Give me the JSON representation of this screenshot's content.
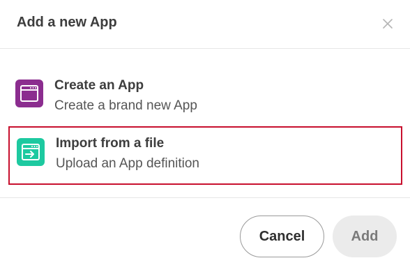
{
  "dialog": {
    "title": "Add a new App",
    "close_icon": "close-icon"
  },
  "options": [
    {
      "title": "Create an App",
      "description": "Create a brand new App",
      "icon": "app-window-icon",
      "icon_color": "#8b2d8f",
      "selected": false
    },
    {
      "title": "Import from a file",
      "description": "Upload an App definition",
      "icon": "import-window-icon",
      "icon_color": "#1dc9a0",
      "selected": true
    }
  ],
  "selection_outline_color": "#c8102e",
  "buttons": {
    "cancel_label": "Cancel",
    "add_label": "Add"
  }
}
